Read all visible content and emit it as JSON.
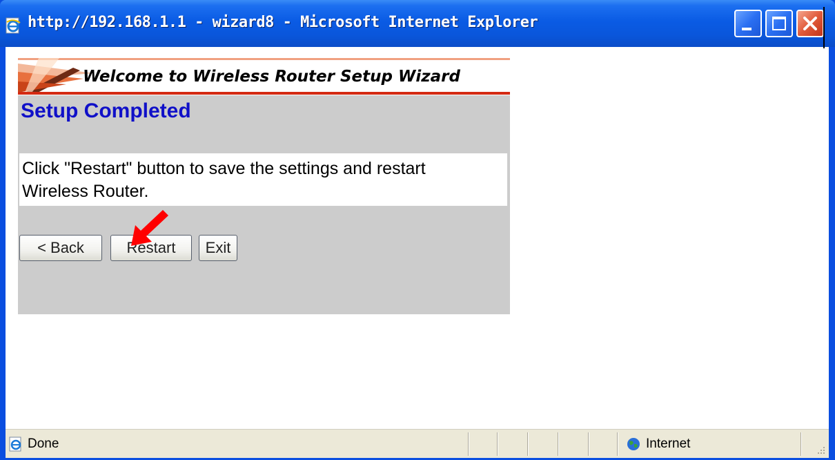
{
  "window": {
    "title": "http://192.168.1.1 - wizard8 - Microsoft Internet Explorer",
    "icon": "ie-page-icon",
    "controls": [
      "minimize-icon",
      "maximize-icon",
      "close-icon"
    ]
  },
  "page": {
    "banner_text": "Welcome to Wireless Router Setup Wizard",
    "heading": "Setup Completed",
    "message": "Click \"Restart\" button to save the settings and restart Wireless Router.",
    "buttons": {
      "back": "< Back",
      "restart": "Restart",
      "exit": "Exit"
    },
    "annotation": "red-arrow-pointing-to-restart"
  },
  "statusbar": {
    "status": "Done",
    "zone": "Internet",
    "status_icon": "ie-page-icon",
    "zone_icon": "globe-icon"
  },
  "colors": {
    "titlebar": "#0a5be4",
    "heading": "#1010c8",
    "panel_bg": "#cccccc",
    "banner_accent": "#d42a12",
    "arrow": "#ff0000"
  }
}
